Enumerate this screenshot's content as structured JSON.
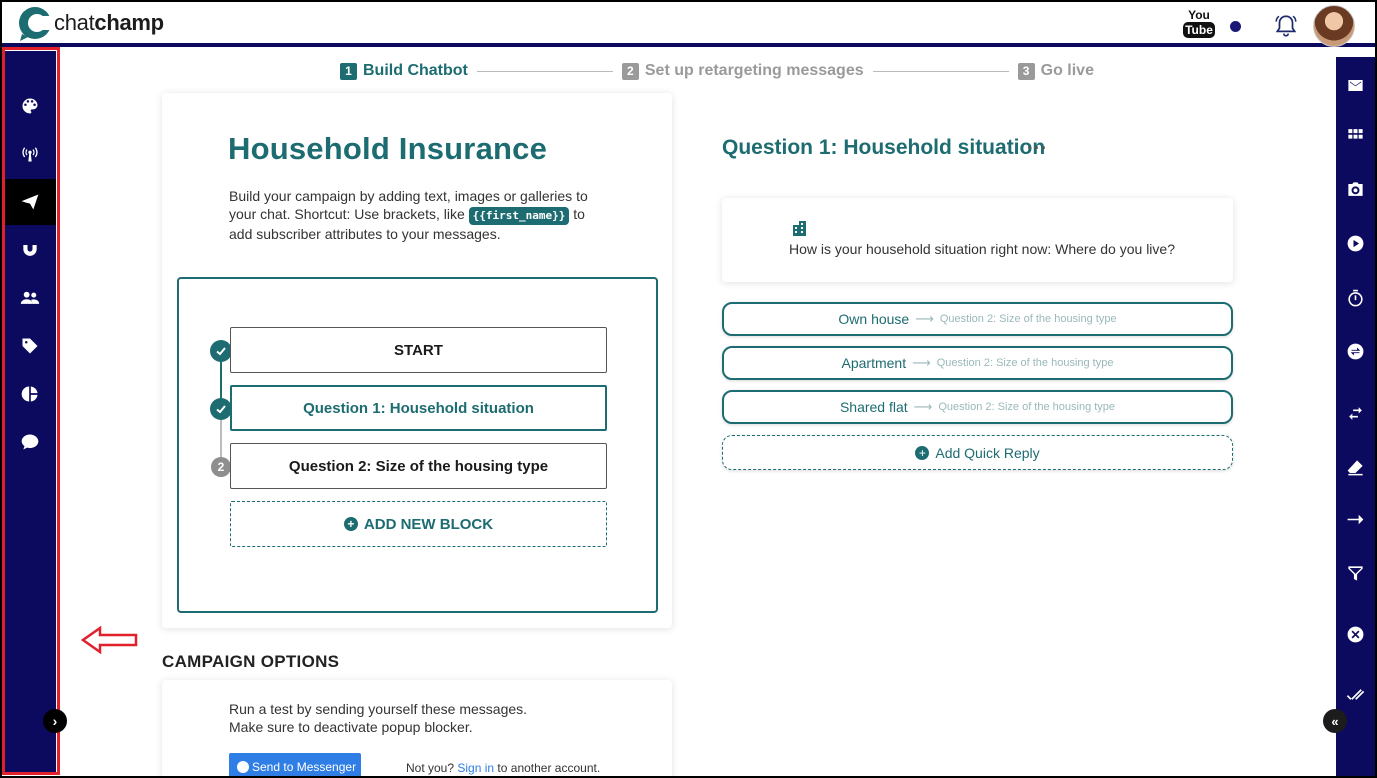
{
  "app": {
    "logo_text_light": "chat",
    "logo_text_bold": "champ"
  },
  "header": {
    "youtube_top": "You",
    "youtube_bottom": "Tube"
  },
  "stepper": {
    "steps": [
      {
        "num": "1",
        "label": "Build Chatbot"
      },
      {
        "num": "2",
        "label": "Set up retargeting messages"
      },
      {
        "num": "3",
        "label": "Go live"
      }
    ]
  },
  "campaign": {
    "title": "Household Insurance",
    "desc_part1": "Build your campaign by adding text, images or galleries to your chat. Shortcut: Use brackets, like ",
    "desc_code": "{{first_name}}",
    "desc_part2": " to add subscriber attributes to your messages.",
    "blocks": [
      {
        "label": "START",
        "state": "done"
      },
      {
        "label": "Question 1: Household situation",
        "state": "done"
      },
      {
        "label": "Question 2: Size of the housing type",
        "state": "2"
      }
    ],
    "add_block_label": "ADD NEW BLOCK"
  },
  "options": {
    "section_title": "CAMPAIGN OPTIONS",
    "text_line1": "Run a test by sending yourself these messages.",
    "text_line2": "Make sure to deactivate popup blocker.",
    "messenger_button": "Send to Messenger",
    "not_you": "Not you?",
    "sign_in": "Sign in",
    "another_account": "to another account."
  },
  "question": {
    "title": "Question 1: Household situation",
    "more": "···",
    "text": "How is your household situation right now: Where do you live?",
    "quick_replies": [
      {
        "label": "Own house",
        "target": "Question 2: Size of the housing type"
      },
      {
        "label": "Apartment",
        "target": "Question 2: Size of the housing type"
      },
      {
        "label": "Shared flat",
        "target": "Question 2: Size of the housing type"
      }
    ],
    "add_quick_reply": "Add Quick Reply"
  },
  "icons": {
    "left_sidebar": [
      "palette-icon",
      "broadcast-icon",
      "send-icon",
      "magnet-icon",
      "people-icon",
      "tag-icon",
      "pie-chart-icon",
      "chat-bubble-icon"
    ],
    "right_sidebar": [
      "mail-icon",
      "grid-icon",
      "camera-icon",
      "play-icon",
      "timer-icon",
      "swap-icon",
      "arrows-icon",
      "eraser-icon",
      "arrow-right-icon",
      "filter-icon",
      "close-circle-icon",
      "double-check-icon"
    ]
  },
  "colors": {
    "sidebar": "#0c0a5e",
    "accent": "#1d6c71",
    "highlight": "#e0202a"
  }
}
